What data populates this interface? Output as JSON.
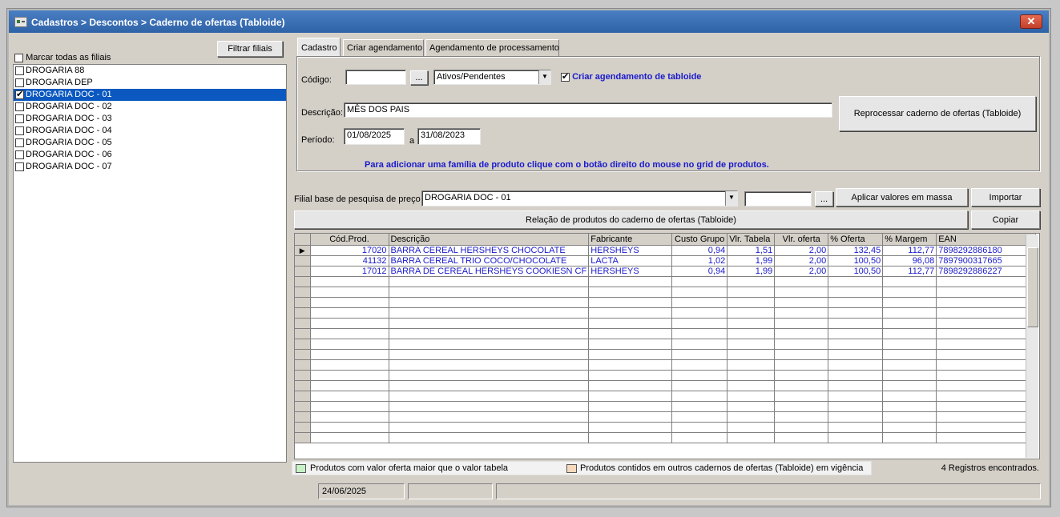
{
  "window": {
    "title": "Cadastros > Descontos > Caderno de ofertas (Tabloide)",
    "close_glyph": "✕"
  },
  "left": {
    "filter_button": "Filtrar filiais",
    "select_all_label": "Marcar todas as filiais",
    "branches": [
      {
        "label": "DROGARIA 88",
        "checked": false,
        "selected": false
      },
      {
        "label": "DROGARIA DEP",
        "checked": false,
        "selected": false
      },
      {
        "label": "DROGARIA DOC - 01",
        "checked": true,
        "selected": true
      },
      {
        "label": "DROGARIA DOC - 02",
        "checked": false,
        "selected": false
      },
      {
        "label": "DROGARIA DOC - 03",
        "checked": false,
        "selected": false
      },
      {
        "label": "DROGARIA DOC - 04",
        "checked": false,
        "selected": false
      },
      {
        "label": "DROGARIA DOC - 05",
        "checked": false,
        "selected": false
      },
      {
        "label": "DROGARIA DOC - 06",
        "checked": false,
        "selected": false
      },
      {
        "label": "DROGARIA DOC - 07",
        "checked": false,
        "selected": false
      }
    ]
  },
  "tabs": [
    {
      "label": "Cadastro",
      "active": true
    },
    {
      "label": "Criar agendamento",
      "active": false
    },
    {
      "label": "Agendamento de processamento",
      "active": false
    }
  ],
  "form": {
    "codigo_label": "Código:",
    "codigo_value": "",
    "ellipsis": "...",
    "status_select": "Ativos/Pendentes",
    "schedule_checkbox_label": "Criar agendamento de tabloide",
    "descricao_label": "Descrição:",
    "descricao_value": "MÊS DOS PAIS",
    "periodo_label": "Período:",
    "period_start": "01/08/2025",
    "period_sep": "a",
    "period_end": "31/08/2023",
    "reprocess_button": "Reprocessar caderno de ofertas (Tabloide)",
    "hint": "Para adicionar uma família de produto clique com o botão direito do  mouse no grid de produtos."
  },
  "pricing": {
    "base_label": "Filial base de pesquisa de preço",
    "base_select": "DROGARIA DOC - 01",
    "mass_value": "",
    "ellipsis": "...",
    "mass_button": "Aplicar valores em massa",
    "import_button": "Importar",
    "relation_button": "Relação de produtos do caderno de ofertas (Tabloide)",
    "copy_button": "Copiar"
  },
  "grid": {
    "columns": [
      "Cód.Prod.",
      "Descrição",
      "Fabricante",
      "Custo Grupo",
      "Vlr. Tabela",
      "Vlr. oferta",
      "% Oferta",
      "% Margem",
      "EAN"
    ],
    "rows": [
      [
        "17020",
        "BARRA CEREAL HERSHEYS CHOCOLATE",
        "HERSHEYS",
        "0,94",
        "1,51",
        "2,00",
        "132,45",
        "112,77",
        "7898292886180"
      ],
      [
        "41132",
        "BARRA CEREAL TRIO  COCO/CHOCOLATE",
        "LACTA",
        "1,02",
        "1,99",
        "2,00",
        "100,50",
        "96,08",
        "7897900317665"
      ],
      [
        "17012",
        "BARRA DE CEREAL HERSHEYS COOKIESN CF",
        "HERSHEYS",
        "0,94",
        "1,99",
        "2,00",
        "100,50",
        "112,77",
        "7898292886227"
      ]
    ],
    "current_row_marker": "▶"
  },
  "legend": {
    "green_label": "Produtos com valor oferta maior que o valor tabela",
    "green_color": "#c6f2c6",
    "orange_label": "Produtos contidos em outros cadernos de ofertas (Tabloide) em vigência",
    "orange_color": "#f7d9bd",
    "records": "4 Registros encontrados."
  },
  "status": {
    "date": "24/06/2025"
  }
}
